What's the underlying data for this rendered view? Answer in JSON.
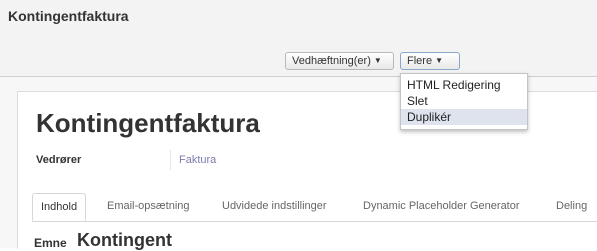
{
  "header": {
    "breadcrumb": "Kontingentfaktura"
  },
  "toolbar": {
    "attachments_label": "Vedhæftning(er)",
    "more_label": "Flere"
  },
  "dropdown": {
    "items": [
      "HTML Redigering",
      "Slet",
      "Duplikér"
    ],
    "highlighted": "Duplikér"
  },
  "form": {
    "title": "Kontingentfaktura",
    "field_label": "Vedrører",
    "field_value": "Faktura",
    "tabs": [
      "Indhold",
      "Email-opsætning",
      "Udvidede indstillinger",
      "Dynamic Placeholder Generator",
      "Deling"
    ],
    "active_tab": "Indhold",
    "subject_label": "Emne",
    "subject_value": "Kontingent"
  },
  "colors": {
    "link": "#7c7bad",
    "highlight": "#dfe3ee"
  }
}
